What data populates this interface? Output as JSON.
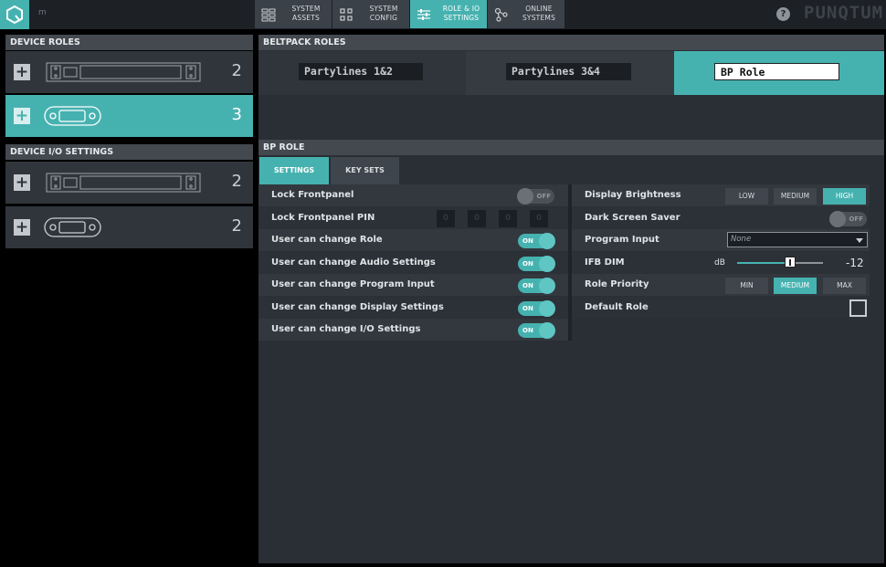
{
  "topbar": {
    "dim_label": "m",
    "nav": [
      {
        "line1": "SYSTEM",
        "line2": "ASSETS"
      },
      {
        "line1": "SYSTEM",
        "line2": "CONFIG"
      },
      {
        "line1": "ROLE & IO",
        "line2": "SETTINGS"
      },
      {
        "line1": "ONLINE",
        "line2": "SYSTEMS"
      }
    ],
    "active_nav": "ROLE & IO SETTINGS",
    "help_label": "?",
    "brand": "PUNQTUM"
  },
  "left": {
    "device_roles_title": "DEVICE ROLES",
    "device_roles": [
      {
        "icon": "rack-unit-icon",
        "count": "2",
        "selected": false
      },
      {
        "icon": "beltpack-icon",
        "count": "3",
        "selected": true
      }
    ],
    "io_settings_title": "DEVICE I/O SETTINGS",
    "io_devices": [
      {
        "icon": "rack-unit-icon",
        "count": "2"
      },
      {
        "icon": "beltpack-icon",
        "count": "2"
      }
    ]
  },
  "beltpack_roles": {
    "title": "BELTPACK ROLES",
    "roles": [
      {
        "name": "Partylines 1&2",
        "selected": false
      },
      {
        "name": "Partylines 3&4",
        "selected": false
      },
      {
        "name": "BP Role",
        "selected": true
      }
    ]
  },
  "bp_role": {
    "title": "BP ROLE",
    "tabs": [
      "SETTINGS",
      "KEY SETS"
    ],
    "active_tab": "SETTINGS",
    "left_settings": [
      {
        "label": "Lock Frontpanel",
        "type": "toggle",
        "value": "OFF"
      },
      {
        "label": "Lock Frontpanel PIN",
        "type": "pin",
        "digits": [
          "0",
          "0",
          "0",
          "0"
        ]
      },
      {
        "label": "User can change Role",
        "type": "toggle",
        "value": "ON"
      },
      {
        "label": "User can change Audio Settings",
        "type": "toggle",
        "value": "ON"
      },
      {
        "label": "User can change Program Input",
        "type": "toggle",
        "value": "ON"
      },
      {
        "label": "User can change Display Settings",
        "type": "toggle",
        "value": "ON"
      },
      {
        "label": "User can change I/O Settings",
        "type": "toggle",
        "value": "ON"
      }
    ],
    "right_settings": {
      "display_brightness": {
        "label": "Display Brightness",
        "options": [
          "LOW",
          "MEDIUM",
          "HIGH"
        ],
        "selected": "HIGH"
      },
      "dark_screen_saver": {
        "label": "Dark Screen Saver",
        "value": "OFF"
      },
      "program_input": {
        "label": "Program Input",
        "value": "None"
      },
      "ifb_dim": {
        "label": "IFB DIM",
        "unit": "dB",
        "value": "-12",
        "slider_fraction": 0.62
      },
      "role_priority": {
        "label": "Role Priority",
        "options": [
          "MIN",
          "MEDIUM",
          "MAX"
        ],
        "selected": "MEDIUM"
      },
      "default_role": {
        "label": "Default Role",
        "checked": false
      }
    }
  },
  "colors": {
    "accent": "#46b2b0",
    "panel": "#2a2f35",
    "header": "#43494f",
    "topbar": "#1d2126"
  }
}
